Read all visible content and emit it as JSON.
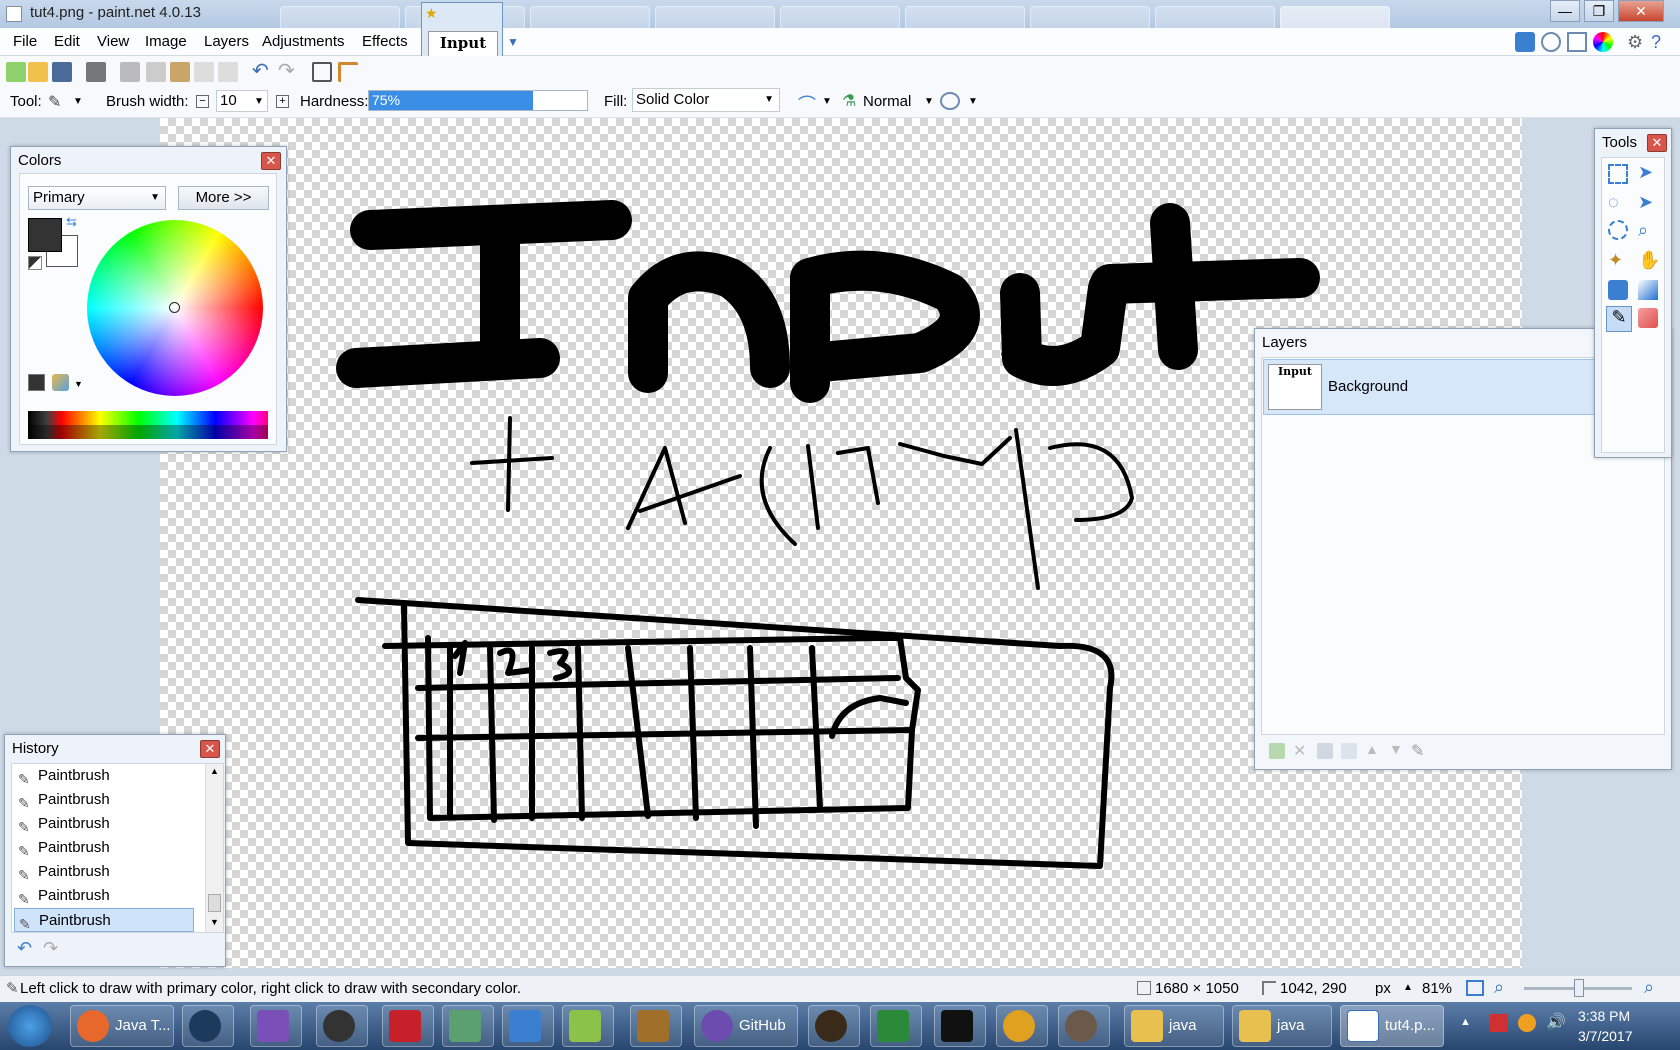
{
  "window": {
    "title": "tut4.png - paint.net 4.0.13"
  },
  "window_buttons": {
    "minimize": "—",
    "restore": "❐",
    "close": "✕"
  },
  "menu": [
    "File",
    "Edit",
    "View",
    "Image",
    "Layers",
    "Adjustments",
    "Effects"
  ],
  "image_tab": {
    "thumbnail_text": "Input",
    "modified_marker": "★"
  },
  "toolbar2": {
    "tool_label": "Tool:",
    "brush_width_label": "Brush width:",
    "brush_width_value": "10",
    "hardness_label": "Hardness:",
    "hardness_value": "75%",
    "hardness_fraction": 0.75,
    "fill_label": "Fill:",
    "fill_value": "Solid Color",
    "blend_mode": "Normal"
  },
  "colors_panel": {
    "title": "Colors",
    "selector": "Primary",
    "more_button": "More >>",
    "primary_color": "#333333",
    "secondary_color": "#ffffff"
  },
  "history_panel": {
    "title": "History",
    "items": [
      "Paintbrush",
      "Paintbrush",
      "Paintbrush",
      "Paintbrush",
      "Paintbrush",
      "Paintbrush",
      "Paintbrush"
    ],
    "selected_index": 6
  },
  "layers_panel": {
    "title": "Layers",
    "layers": [
      {
        "name": "Background",
        "visible": true
      }
    ]
  },
  "tools_panel": {
    "title": "Tools"
  },
  "canvas_text": {
    "line1": "Input",
    "line2": "+ arrays"
  },
  "status": {
    "hint": "Left click to draw with primary color, right click to draw with secondary color.",
    "image_size": "1680 × 1050",
    "cursor_pos": "1042, 290",
    "unit": "px",
    "zoom": "81%"
  },
  "taskbar": {
    "items": [
      "Java T...",
      "GitHub",
      "java",
      "java",
      "tut4.p..."
    ],
    "clock_time": "3:38 PM",
    "clock_date": "3/7/2017"
  }
}
